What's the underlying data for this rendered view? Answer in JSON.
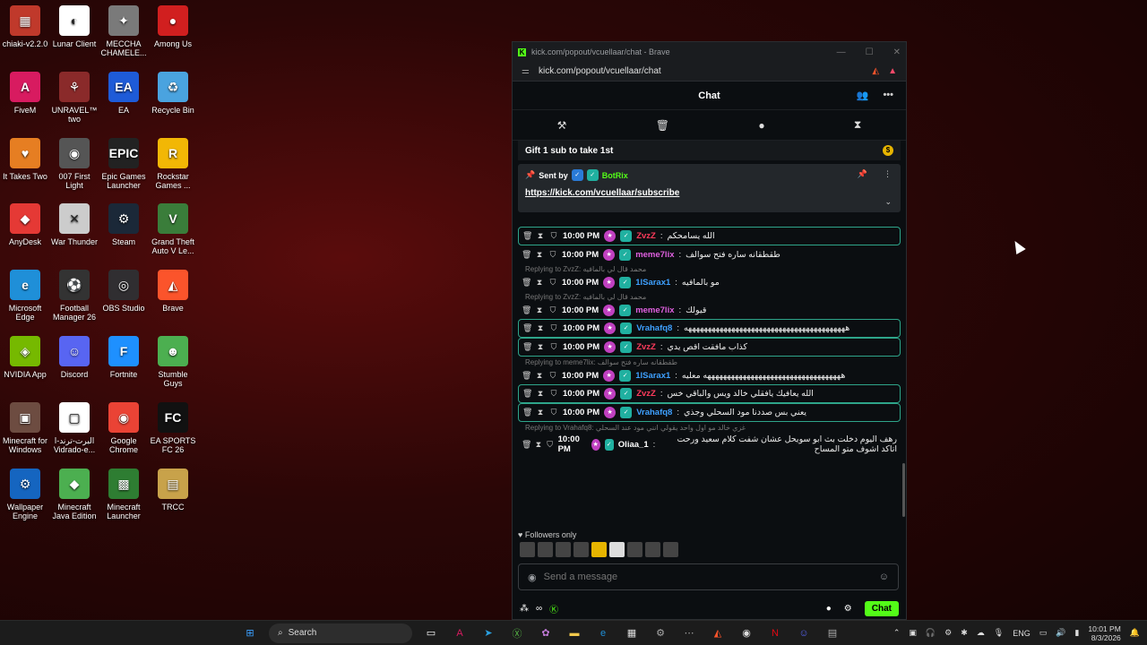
{
  "desktop_icons": [
    {
      "label": "chiaki-v2.2.0",
      "color": "#c0392b",
      "glyph": "▦"
    },
    {
      "label": "Lunar Client",
      "color": "#ffffff",
      "glyph": "◐"
    },
    {
      "label": "MECCHA CHAMELE...",
      "color": "#7a7a7a",
      "glyph": "✦"
    },
    {
      "label": "Among Us",
      "color": "#d11f1f",
      "glyph": "●"
    },
    {
      "label": "FiveM",
      "color": "#d81b60",
      "glyph": "A"
    },
    {
      "label": "UNRAVEL™ two",
      "color": "#8a2a2a",
      "glyph": "⚘"
    },
    {
      "label": "EA",
      "color": "#1e5bd8",
      "glyph": "EA"
    },
    {
      "label": "Recycle Bin",
      "color": "#4aa3df",
      "glyph": "♻"
    },
    {
      "label": "It Takes Two",
      "color": "#e67e22",
      "glyph": "♥"
    },
    {
      "label": "007 First Light",
      "color": "#555555",
      "glyph": "◉"
    },
    {
      "label": "Epic Games Launcher",
      "color": "#222222",
      "glyph": "EPIC"
    },
    {
      "label": "Rockstar Games ...",
      "color": "#f2b705",
      "glyph": "R"
    },
    {
      "label": "AnyDesk",
      "color": "#e53935",
      "glyph": "◆"
    },
    {
      "label": "War Thunder",
      "color": "#cccccc",
      "glyph": "✕"
    },
    {
      "label": "Steam",
      "color": "#1b2838",
      "glyph": "⚙"
    },
    {
      "label": "Grand Theft Auto V Le...",
      "color": "#3a7d3a",
      "glyph": "V"
    },
    {
      "label": "Microsoft Edge",
      "color": "#1f8fd8",
      "glyph": "e"
    },
    {
      "label": "Football Manager 26",
      "color": "#333333",
      "glyph": "⚽"
    },
    {
      "label": "OBS Studio",
      "color": "#302e31",
      "glyph": "◎"
    },
    {
      "label": "Brave",
      "color": "#fb542b",
      "glyph": "◭"
    },
    {
      "label": "NVIDIA App",
      "color": "#76b900",
      "glyph": "◈"
    },
    {
      "label": "Discord",
      "color": "#5865f2",
      "glyph": "☺"
    },
    {
      "label": "Fortnite",
      "color": "#1e90ff",
      "glyph": "F"
    },
    {
      "label": "Stumble Guys",
      "color": "#4caf50",
      "glyph": "☻"
    },
    {
      "label": "Minecraft for Windows",
      "color": "#6d4c41",
      "glyph": "▣"
    },
    {
      "label": "البرت-ترند-ا Vidrado-e...",
      "color": "#ffffff",
      "glyph": "▢"
    },
    {
      "label": "Google Chrome",
      "color": "#ea4335",
      "glyph": "◉"
    },
    {
      "label": "EA SPORTS FC 26",
      "color": "#111111",
      "glyph": "FC"
    },
    {
      "label": "Wallpaper Engine",
      "color": "#1565c0",
      "glyph": "⚙"
    },
    {
      "label": "Minecraft Java Edition",
      "color": "#4caf50",
      "glyph": "◆"
    },
    {
      "label": "Minecraft Launcher",
      "color": "#2e7d32",
      "glyph": "▩"
    },
    {
      "label": "TRCC",
      "color": "#c8a24a",
      "glyph": "▤"
    }
  ],
  "window": {
    "title": "kick.com/popout/vcuellaar/chat - Brave",
    "url": "kick.com/popout/vcuellaar/chat",
    "chat_title": "Chat"
  },
  "goal": {
    "text": "Gift 1 sub to take 1st"
  },
  "pinned": {
    "sent_by_label": "Sent by",
    "sender": "BotRix",
    "link": "https://kick.com/vcuellaar/subscribe"
  },
  "messages": [
    {
      "time": "10:00 PM",
      "user": "ZvzZ",
      "user_color": "#ff3b5c",
      "text": "الله يسامحكم",
      "highlight": true,
      "reply": ""
    },
    {
      "time": "10:00 PM",
      "user": "meme7lix",
      "user_color": "#e060e0",
      "text": "طقطقانه ساره فتح سوالف",
      "highlight": false,
      "reply": ""
    },
    {
      "time": "10:00 PM",
      "user": "1lSarax1",
      "user_color": "#3ea0ff",
      "text": "مو بالمافيه",
      "highlight": false,
      "reply": "Replying to ZvzZ: محمد قال لي بالمافيه"
    },
    {
      "time": "10:00 PM",
      "user": "meme7lix",
      "user_color": "#e060e0",
      "text": "قيولك",
      "highlight": false,
      "reply": "Replying to ZvzZ: محمد قال لي بالمافيه"
    },
    {
      "time": "10:00 PM",
      "user": "Vrahafq8",
      "user_color": "#3ea0ff",
      "text": "هههههههههههههههههههههههههههههههههههههههههه",
      "highlight": true,
      "reply": ""
    },
    {
      "time": "10:00 PM",
      "user": "ZvzZ",
      "user_color": "#ff3b5c",
      "text": "كذاب مافقت اقص يدي",
      "highlight": true,
      "reply": ""
    },
    {
      "time": "10:00 PM",
      "user": "1lSarax1",
      "user_color": "#3ea0ff",
      "text": "هههههههههههههههههههههههههههههههههههه معليه",
      "highlight": false,
      "reply": "Replying to meme7lix: طقطقانه ساره فتح سوالف"
    },
    {
      "time": "10:00 PM",
      "user": "ZvzZ",
      "user_color": "#ff3b5c",
      "text": "الله يعافيك يافقلي خالد ويس والباقي خس",
      "highlight": true,
      "reply": ""
    },
    {
      "time": "10:00 PM",
      "user": "Vrahafq8",
      "user_color": "#3ea0ff",
      "text": "يعني بس صددنا مود السحلي وجذي",
      "highlight": true,
      "reply": ""
    },
    {
      "time": "10:00 PM",
      "user": "Oliaa_1",
      "user_color": "#ffffff",
      "text": "رهف اليوم دخلت بث ابو سويحل عشان شفت كلام سعيد ورحت اتاكد اشوف متو المساح",
      "highlight": false,
      "reply": "Replying to Vrahafq8: غزي خالد مو اول واحد يقولي انني مود عند السحلي"
    }
  ],
  "followers_label": "Followers only",
  "input": {
    "placeholder": "Send a message"
  },
  "chat_button": "Chat",
  "taskbar": {
    "search_label": "Search",
    "lang": "ENG",
    "time": "10:01 PM",
    "date": "8/3/2026"
  }
}
